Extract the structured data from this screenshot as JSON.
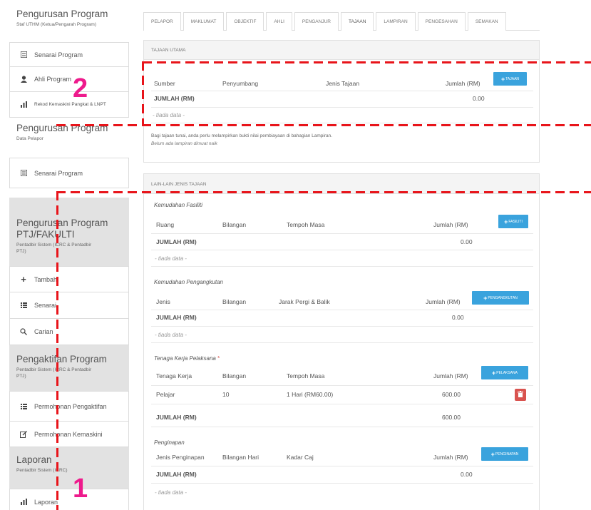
{
  "sidebar": {
    "group1": {
      "title": "Pengurusan Program",
      "subtitle": "Staf UTHM (Ketua/Pengarah Program)",
      "items": [
        {
          "label": "Senarai Program",
          "icon": "list-icon"
        },
        {
          "label": "Ahli Program",
          "icon": "user-icon"
        },
        {
          "label": "Rekod Kemaskini Pangkat & LNPT",
          "icon": "bar-chart-icon"
        }
      ]
    },
    "group2": {
      "title": "Pengurusan Program",
      "subtitle": "Data Pelapor",
      "items": [
        {
          "label": "Senarai Program",
          "icon": "list-icon"
        }
      ]
    },
    "group3": {
      "title": "Pengurusan Program PTJ/FAKULTI",
      "subtitle": "Pentadbir Sistem (ICRC & Pentadbir PTJ)",
      "items": [
        {
          "label": "Tambah",
          "icon": "plus-icon"
        },
        {
          "label": "Senarai",
          "icon": "list-icon"
        },
        {
          "label": "Carian",
          "icon": "search-icon"
        }
      ]
    },
    "group4": {
      "title": "Pengaktifan Program",
      "subtitle": "Pentadbir Sistem (ICRC & Pentadbir PTJ)",
      "items": [
        {
          "label": "Permohonan Pengaktifan",
          "icon": "list-icon"
        },
        {
          "label": "Permohonan Kemaskini",
          "icon": "edit-icon"
        }
      ]
    },
    "group5": {
      "title": "Laporan",
      "subtitle": "Pentadbir Sistem (ICRC)",
      "items": [
        {
          "label": "Laporan",
          "icon": "bar-chart-icon"
        }
      ]
    }
  },
  "tabs": [
    "PELAPOR",
    "MAKLUMAT",
    "OBJEKTIF",
    "AHLI",
    "PENGANJUR",
    "TAJAAN",
    "LAMPIRAN",
    "PENGESAHAN",
    "SEMAKAN"
  ],
  "active_tab": "TAJAAN",
  "tajaan_utama": {
    "heading": "TAJAAN UTAMA",
    "columns": [
      "Sumber",
      "Penyumbang",
      "Jenis Tajaan",
      "Jumlah (RM)"
    ],
    "add_button": "TAJAAN",
    "total_label": "JUMLAH (RM)",
    "total_value": "0.00",
    "empty": "- tiada data -",
    "note": "Bagi tajaan tunai, anda perlu melampirkan bukti nilai pembiayaan di bahagian Lampiran.",
    "note_warning": "Belum ada lampiran dimuat naik"
  },
  "lain_lain": {
    "heading": "LAIN-LAIN JENIS TAJAAN",
    "fasiliti": {
      "title": "Kemudahan Fasiliti",
      "columns": [
        "Ruang",
        "Bilangan",
        "Tempoh Masa",
        "Jumlah (RM)"
      ],
      "add_button": "FASILITI",
      "total_label": "JUMLAH (RM)",
      "total_value": "0.00",
      "empty": "- tiada data -"
    },
    "pengangkutan": {
      "title": "Kemudahan Pengangkutan",
      "columns": [
        "Jenis",
        "Bilangan",
        "Jarak Pergi & Balik",
        "Jumlah (RM)"
      ],
      "add_button": "PENGANGKUTAN",
      "total_label": "JUMLAH (RM)",
      "total_value": "0.00",
      "empty": "- tiada data -"
    },
    "tenaga": {
      "title": "Tenaga Kerja Pelaksana",
      "required": "*",
      "columns": [
        "Tenaga Kerja",
        "Bilangan",
        "Tempoh Masa",
        "Jumlah (RM)"
      ],
      "add_button": "PELAKSANA",
      "rows": [
        {
          "jenis": "Pelajar",
          "bilangan": "10",
          "tempoh": "1 Hari (RM60.00)",
          "jumlah": "600.00"
        }
      ],
      "total_label": "JUMLAH (RM)",
      "total_value": "600.00"
    },
    "penginapan": {
      "title": "Penginapan",
      "columns": [
        "Jenis Penginapan",
        "Bilangan Hari",
        "Kadar Caj",
        "Jumlah (RM)"
      ],
      "add_button": "PENGINAPAN",
      "total_label": "JUMLAH (RM)",
      "total_value": "0.00",
      "empty": "- tiada data -"
    }
  },
  "callouts": {
    "one": "1",
    "two": "2"
  },
  "colors": {
    "accent": "#3aa3dd",
    "danger": "#d9534f",
    "annotation": "#e8141a",
    "callout": "#ee1a8c"
  }
}
